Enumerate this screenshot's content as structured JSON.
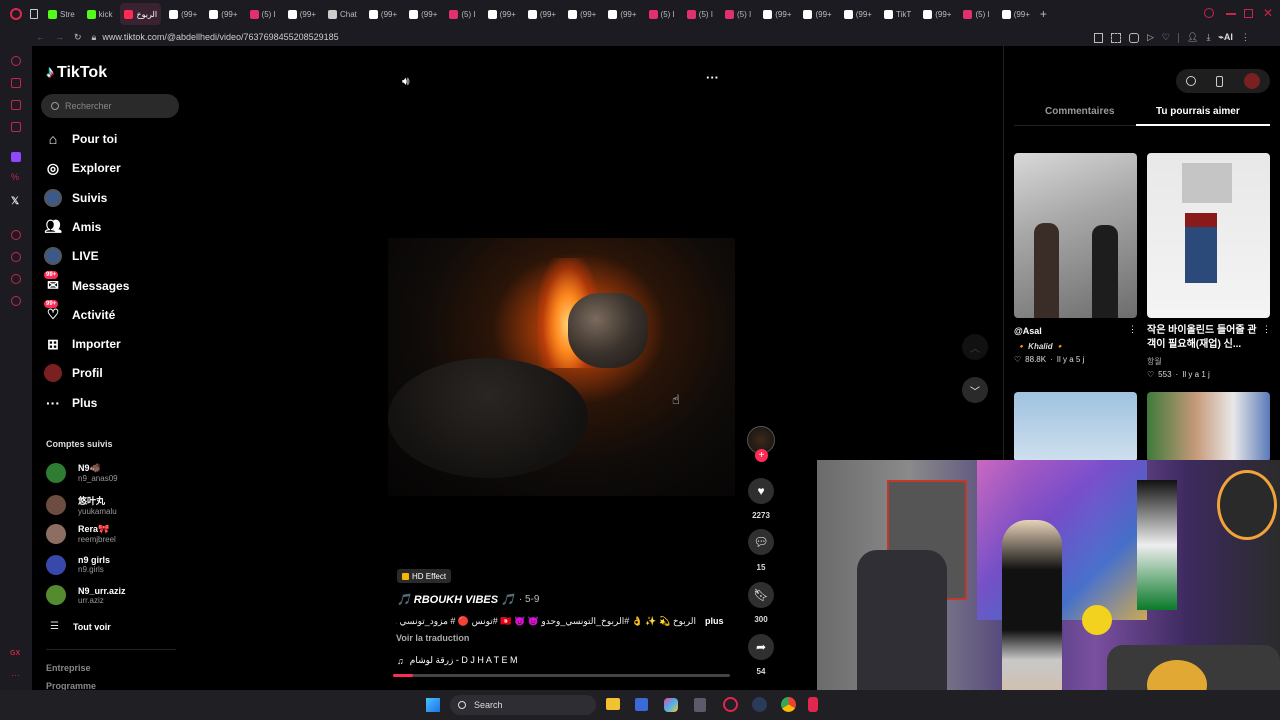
{
  "browser": {
    "tabs": [
      {
        "label": "Stre",
        "color": "#53fc18"
      },
      {
        "label": "kick",
        "color": "#53fc18"
      },
      {
        "label": "الربوخ",
        "color": "#ff2b55",
        "active": true
      },
      {
        "label": "(99+",
        "color": "#ffffff"
      },
      {
        "label": "(99+",
        "color": "#ffffff"
      },
      {
        "label": "(5) I",
        "color": "#e1306c"
      },
      {
        "label": "(99+",
        "color": "#ffffff"
      },
      {
        "label": "Chat",
        "color": "#cccccc"
      },
      {
        "label": "(99+",
        "color": "#ffffff"
      },
      {
        "label": "(99+",
        "color": "#ffffff"
      },
      {
        "label": "(5) I",
        "color": "#e1306c"
      },
      {
        "label": "(99+",
        "color": "#ffffff"
      },
      {
        "label": "(99+",
        "color": "#ffffff"
      },
      {
        "label": "(99+",
        "color": "#ffffff"
      },
      {
        "label": "(99+",
        "color": "#ffffff"
      },
      {
        "label": "(5) I",
        "color": "#e1306c"
      },
      {
        "label": "(5) I",
        "color": "#e1306c"
      },
      {
        "label": "(5) I",
        "color": "#e1306c"
      },
      {
        "label": "(99+",
        "color": "#ffffff"
      },
      {
        "label": "(99+",
        "color": "#ffffff"
      },
      {
        "label": "(99+",
        "color": "#ffffff"
      },
      {
        "label": "TikT",
        "color": "#ffffff"
      },
      {
        "label": "(99+",
        "color": "#ffffff"
      },
      {
        "label": "(5) I",
        "color": "#e1306c"
      },
      {
        "label": "(99+",
        "color": "#ffffff"
      }
    ],
    "new_tab": "+",
    "url": "www.tiktok.com/@abdellhedi/video/7637698455208529185",
    "ai_label": "AI"
  },
  "tiktok": {
    "logo": "TikTok",
    "search_placeholder": "Rechercher",
    "nav": [
      {
        "label": "Pour toi",
        "icon": "home-icon"
      },
      {
        "label": "Explorer",
        "icon": "compass-icon"
      },
      {
        "label": "Suivis",
        "icon": "avatar-icon"
      },
      {
        "label": "Amis",
        "icon": "friends-icon"
      },
      {
        "label": "LIVE",
        "icon": "live-icon"
      },
      {
        "label": "Messages",
        "icon": "messages-icon",
        "badge": "99+"
      },
      {
        "label": "Activité",
        "icon": "activity-icon",
        "badge": "99+"
      },
      {
        "label": "Importer",
        "icon": "upload-icon"
      },
      {
        "label": "Profil",
        "icon": "profile-icon"
      },
      {
        "label": "Plus",
        "icon": "more-icon"
      }
    ],
    "following_title": "Comptes suivis",
    "following": [
      {
        "name": "N9🐗",
        "handle": "n9_anas09",
        "color": "#2e7d32"
      },
      {
        "name": "悠叶丸",
        "handle": "yuukamalu",
        "color": "#6d4c41"
      },
      {
        "name": "Rera🎀",
        "handle": "reemjbreel",
        "color": "#8d6e63"
      },
      {
        "name": "n9 girls",
        "handle": "n9.girls",
        "color": "#3949ab"
      },
      {
        "name": "N9_urr.aziz",
        "handle": "urr.aziz",
        "color": "#558b2f"
      }
    ],
    "see_all": "Tout voir",
    "footer": [
      "Entreprise",
      "Programme"
    ]
  },
  "video": {
    "hd_badge": "HD Effect",
    "author": "🎵 RBOUKH VIBES 🎵",
    "date": "· 5-9",
    "caption": "الربوخ 💫 ✨ 👌 #الربوخ_التونسي_وحدو 😈 😈 🇹🇳 #تونس 🔴 # مزود_تونسي ...",
    "more": "plus",
    "translate": "Voir la traduction",
    "music": "زرقة لوشام - D J H A T E M",
    "progress": 0.06,
    "likes": "2273",
    "comments": "15",
    "saves": "300",
    "shares": "54"
  },
  "right_panel": {
    "tabs": [
      "Commentaires",
      "Tu pourrais aimer"
    ],
    "active_tab": 1,
    "cards": [
      {
        "title": "@Asal",
        "user": "🔸 Khalid 🔸",
        "likes": "88.8K",
        "time": "Il y a 5 j"
      },
      {
        "title": "작은 바이올린드 들어줄 관객이 필요해(재업) 신...",
        "user": "항월",
        "likes": "553",
        "time": "Il y a 1 j"
      }
    ]
  },
  "taskbar": {
    "search": "Search"
  }
}
